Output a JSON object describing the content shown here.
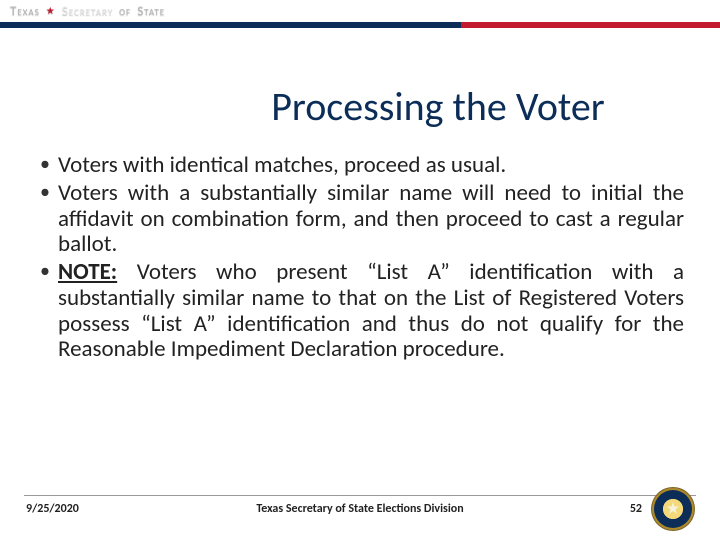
{
  "header": {
    "brand_word1": "Texas",
    "brand_word2": "Secretary",
    "brand_of": "of",
    "brand_word3": "State"
  },
  "title": "Processing the Voter",
  "bullets": [
    {
      "text": "Voters with identical matches, proceed as usual."
    },
    {
      "text": "Voters with a substantially similar name will need to initial the affidavit on combination form, and then proceed to cast a regular ballot."
    },
    {
      "note_label": "NOTE:",
      "text": "Voters who present “List A” identification with a substantially similar name to that on the List of Registered Voters possess “List A” identification and thus do not qualify for the Reasonable Impediment Declaration procedure."
    }
  ],
  "footer": {
    "date": "9/25/2020",
    "org": "Texas Secretary of State Elections Division",
    "page": "52",
    "seal_name": "texas-state-seal"
  }
}
